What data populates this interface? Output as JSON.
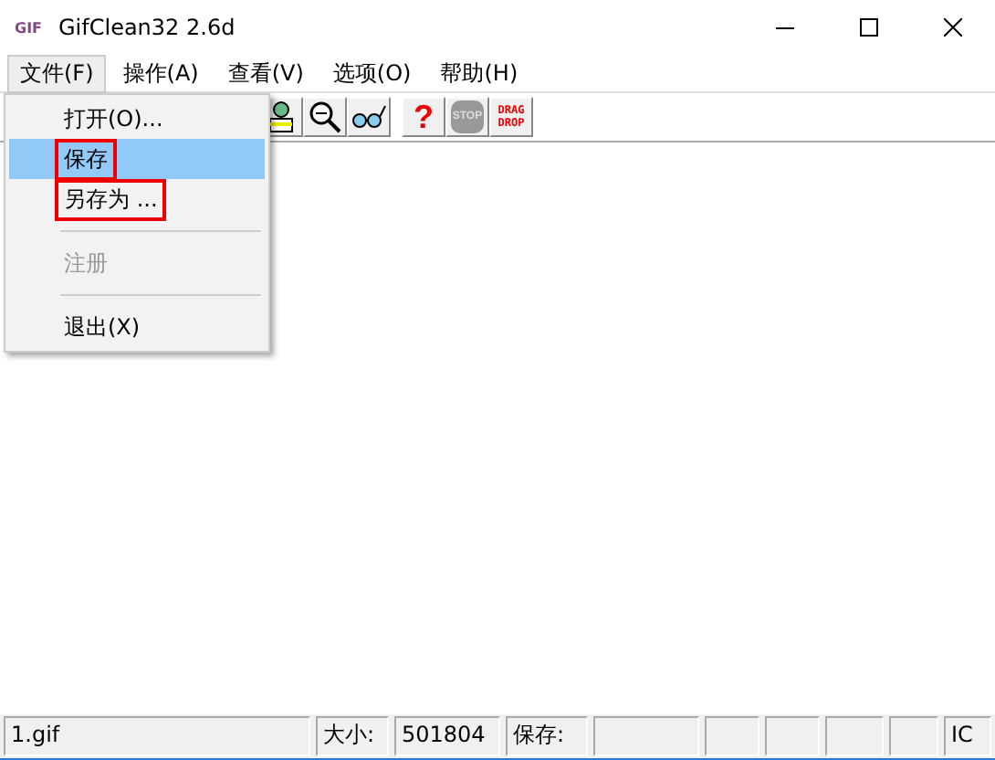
{
  "window": {
    "title": "GifClean32 2.6d",
    "icon_label": "GIF"
  },
  "menu_bar": [
    {
      "label": "文件(F)",
      "selected": true
    },
    {
      "label": "操作(A)",
      "selected": false
    },
    {
      "label": "查看(V)",
      "selected": false
    },
    {
      "label": "选项(O)",
      "selected": false
    },
    {
      "label": "帮助(H)",
      "selected": false
    }
  ],
  "toolbar": [
    {
      "kind": "person"
    },
    {
      "kind": "zoom"
    },
    {
      "kind": "glasses"
    },
    {
      "kind": "gap"
    },
    {
      "kind": "help",
      "label": "?"
    },
    {
      "kind": "stop",
      "label": "STOP",
      "disabled": true
    },
    {
      "kind": "dragdrop",
      "label": "DRAG",
      "label2": "DROP"
    }
  ],
  "file_menu": [
    {
      "kind": "item",
      "label": "打开(O)...",
      "selected": false,
      "disabled": false,
      "annotated": false
    },
    {
      "kind": "item",
      "label": "保存",
      "selected": true,
      "disabled": false,
      "annotated": true
    },
    {
      "kind": "item",
      "label": "另存为 ...",
      "selected": false,
      "disabled": false,
      "annotated": true
    },
    {
      "kind": "separator"
    },
    {
      "kind": "item",
      "label": "注册",
      "selected": false,
      "disabled": true,
      "annotated": false
    },
    {
      "kind": "separator"
    },
    {
      "kind": "item",
      "label": "退出(X)",
      "selected": false,
      "disabled": false,
      "annotated": false
    }
  ],
  "status_bar": [
    {
      "kind": "text",
      "text": "1.gif"
    },
    {
      "kind": "text",
      "text": "大小:"
    },
    {
      "kind": "text",
      "text": "501804"
    },
    {
      "kind": "text",
      "text": "保存:"
    },
    {
      "kind": "blank"
    },
    {
      "kind": "blank"
    },
    {
      "kind": "blank"
    },
    {
      "kind": "blank"
    },
    {
      "kind": "blank"
    },
    {
      "kind": "text",
      "text": "IC"
    }
  ]
}
